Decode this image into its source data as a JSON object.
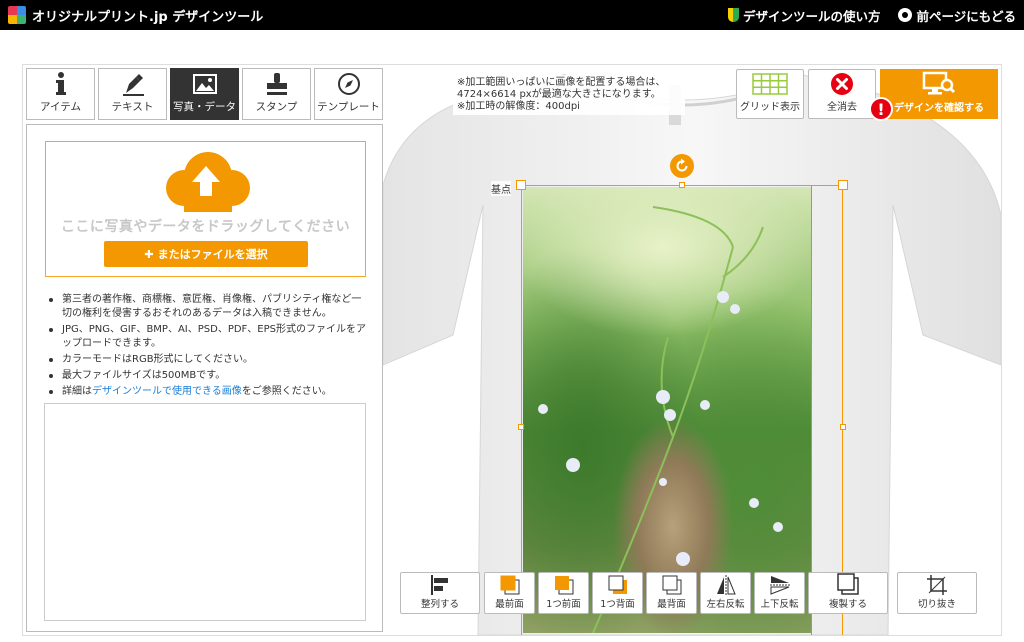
{
  "header": {
    "logo_text": "オリジナルプリント.jp デザインツール",
    "how_to_label": "デザインツールの使い方",
    "back_label": "前ページにもどる"
  },
  "tabs": [
    {
      "label": "アイテム",
      "icon": "info-icon"
    },
    {
      "label": "テキスト",
      "icon": "pen-icon"
    },
    {
      "label": "写真・データ",
      "icon": "image-icon",
      "active": true
    },
    {
      "label": "スタンプ",
      "icon": "stamp-icon"
    },
    {
      "label": "テンプレート",
      "icon": "compass-icon"
    }
  ],
  "upload": {
    "drop_text": "ここに写真やデータをドラッグしてください",
    "file_button": "またはファイルを選択"
  },
  "notes": {
    "n1": "第三者の著作権、商標権、意匠権、肖像権、パブリシティ権など一切の権利を侵害するおそれのあるデータは入稿できません。",
    "n2": "JPG、PNG、GIF、BMP、AI、PSD、PDF、EPS形式のファイルをアップロードできます。",
    "n3": "カラーモードはRGB形式にしてください。",
    "n4": "最大ファイルサイズは500MBです。",
    "n5_prefix": "詳細は",
    "n5_link": "デザインツールで使用できる画像",
    "n5_suffix": "をご参照ください。"
  },
  "hint": {
    "line1": "※加工範囲いっぱいに画像を配置する場合は、",
    "line2": "4724×6614 pxが最適な大きさになります。",
    "line3": "※加工時の解像度：400dpi"
  },
  "toolbar": {
    "grid_label": "グリッド表示",
    "clear_label": "全消去",
    "confirm_label": "デザインを確認する",
    "alert_mark": "!"
  },
  "canvas": {
    "base_label": "基点"
  },
  "bottom_tools": [
    {
      "label": "整列する"
    },
    {
      "label": "最前面"
    },
    {
      "label": "1つ前面"
    },
    {
      "label": "1つ背面"
    },
    {
      "label": "最背面"
    },
    {
      "label": "左右反転"
    },
    {
      "label": "上下反転"
    },
    {
      "label": "複製する"
    },
    {
      "label": "切り抜き"
    }
  ],
  "colors": {
    "accent": "#f39800",
    "alert": "#e60012",
    "link": "#1a7ed6",
    "header_bg": "#000000"
  }
}
